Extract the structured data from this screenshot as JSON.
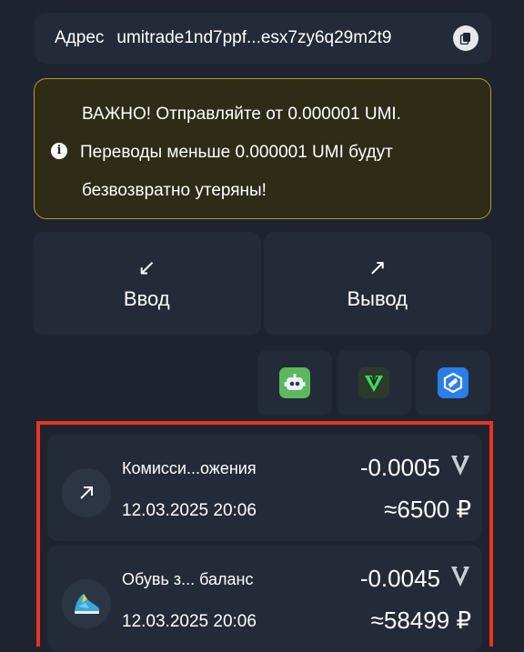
{
  "address": {
    "label": "Адрес",
    "value": "umitrade1nd7ppf...esx7zy6q29m2t9"
  },
  "warning": {
    "line1": "ВАЖНО! Отправляйте от 0.000001 UMI.",
    "line2": "Переводы меньше 0.000001 UMI будут",
    "line3": "безвозвратно утеряны!"
  },
  "actions": {
    "deposit": {
      "arrow": "↙",
      "label": "Ввод"
    },
    "withdraw": {
      "arrow": "↗",
      "label": "Вывод"
    }
  },
  "bots": [
    {
      "name": "robot-bot-icon",
      "color": "#5cb85c"
    },
    {
      "name": "v-logo-bot-icon",
      "color": "#2b3a2b"
    },
    {
      "name": "hexagon-bot-icon",
      "color": "#2a7ee8"
    }
  ],
  "transactions": [
    {
      "title": "Комисси...ожения",
      "date": "12.03.2025 20:06",
      "amount": "-0.0005",
      "fiat": "≈6500 ₽",
      "icon": "arrow-up-right-icon"
    },
    {
      "title": "Обувь з... баланс",
      "date": "12.03.2025 20:06",
      "amount": "-0.0045",
      "fiat": "≈58499 ₽",
      "icon": "sneaker-icon"
    }
  ],
  "colors": {
    "background": "#1d2430",
    "card": "#232b38",
    "warning_border": "#b89a2a",
    "highlight": "#e8331f"
  }
}
